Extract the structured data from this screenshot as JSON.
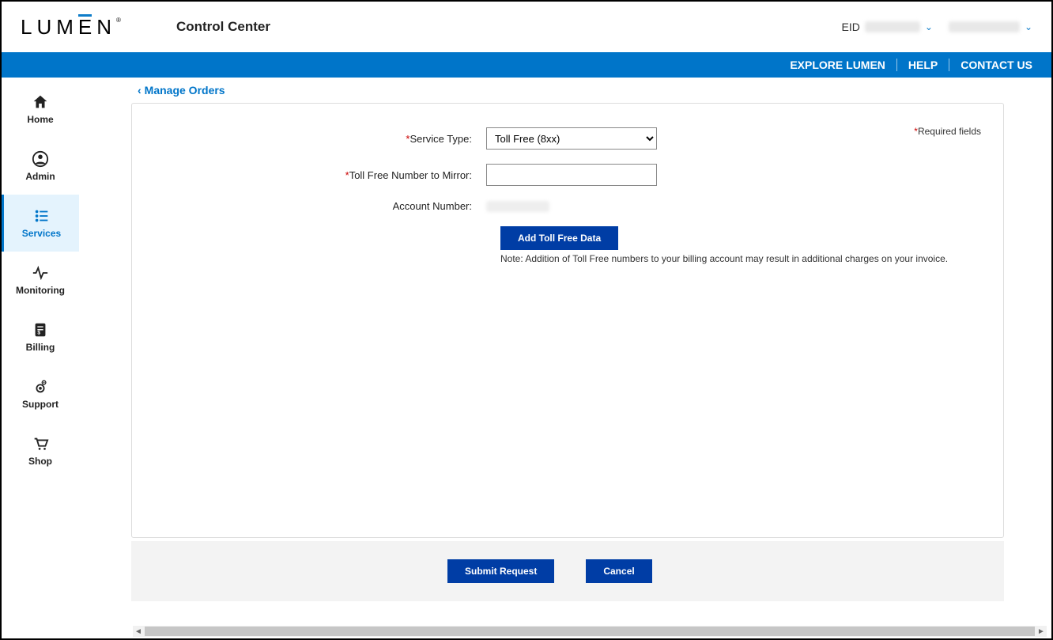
{
  "header": {
    "logo_text": "LUM",
    "logo_text2": "E",
    "logo_text3": "N",
    "app_title": "Control Center",
    "eid_label": "EID"
  },
  "bluebar": {
    "explore": "EXPLORE LUMEN",
    "help": "HELP",
    "contact": "CONTACT US"
  },
  "sidenav": {
    "home": "Home",
    "admin": "Admin",
    "services": "Services",
    "monitoring": "Monitoring",
    "billing": "Billing",
    "support": "Support",
    "shop": "Shop"
  },
  "breadcrumb": {
    "label": "Manage Orders"
  },
  "form": {
    "required_fields": "Required fields",
    "service_type_label": "Service Type:",
    "service_type_value": "Toll Free (8xx)",
    "toll_free_label": "Toll Free Number to Mirror:",
    "toll_free_value": "",
    "account_label": "Account Number:",
    "add_button": "Add Toll Free Data",
    "note": "Note: Addition of Toll Free numbers to your billing account may result in additional charges on your invoice."
  },
  "footer": {
    "submit": "Submit Request",
    "cancel": "Cancel"
  }
}
